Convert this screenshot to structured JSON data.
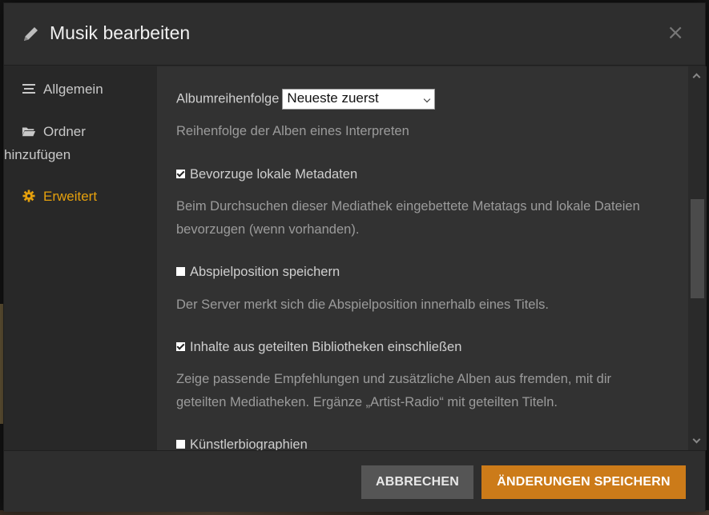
{
  "dialog": {
    "title": "Musik bearbeiten",
    "close_glyph": "×"
  },
  "sidebar": {
    "items": [
      {
        "label": "Allgemein",
        "icon": "list-icon",
        "active": false
      },
      {
        "label_line1": "Ordner",
        "label_line2": "hinzufügen",
        "icon": "folder-icon",
        "active": false
      },
      {
        "label": "Erweitert",
        "icon": "gear-icon",
        "active": true
      }
    ]
  },
  "settings": {
    "album_order": {
      "label": "Albumreihenfolge",
      "selected": "Neueste zuerst",
      "description": "Reihenfolge der Alben eines Interpreten"
    },
    "prefer_local_metadata": {
      "label": "Bevorzuge lokale Metadaten",
      "checked": true,
      "description": "Beim Durchsuchen dieser Mediathek eingebettete Metatags und lokale Dateien bevorzugen (wenn vorhanden)."
    },
    "save_play_position": {
      "label": "Abspielposition speichern",
      "checked": false,
      "description": "Der Server merkt sich die Abspielposition innerhalb eines Titels."
    },
    "include_shared_libraries": {
      "label": "Inhalte aus geteilten Bibliotheken einschließen",
      "checked": true,
      "description": "Zeige passende Empfehlungen und zusätzliche Alben aus fremden, mit dir geteilten Mediatheken. Ergänze „Artist-Radio“ mit geteilten Titeln."
    },
    "artist_bios": {
      "label": "Künstlerbiographien",
      "checked": false
    }
  },
  "footer": {
    "cancel_label": "ABBRECHEN",
    "save_label": "ÄNDERUNGEN SPEICHERN"
  },
  "colors": {
    "accent": "#e5a00d",
    "save_button": "#cc7b19",
    "cancel_button": "#555555"
  }
}
